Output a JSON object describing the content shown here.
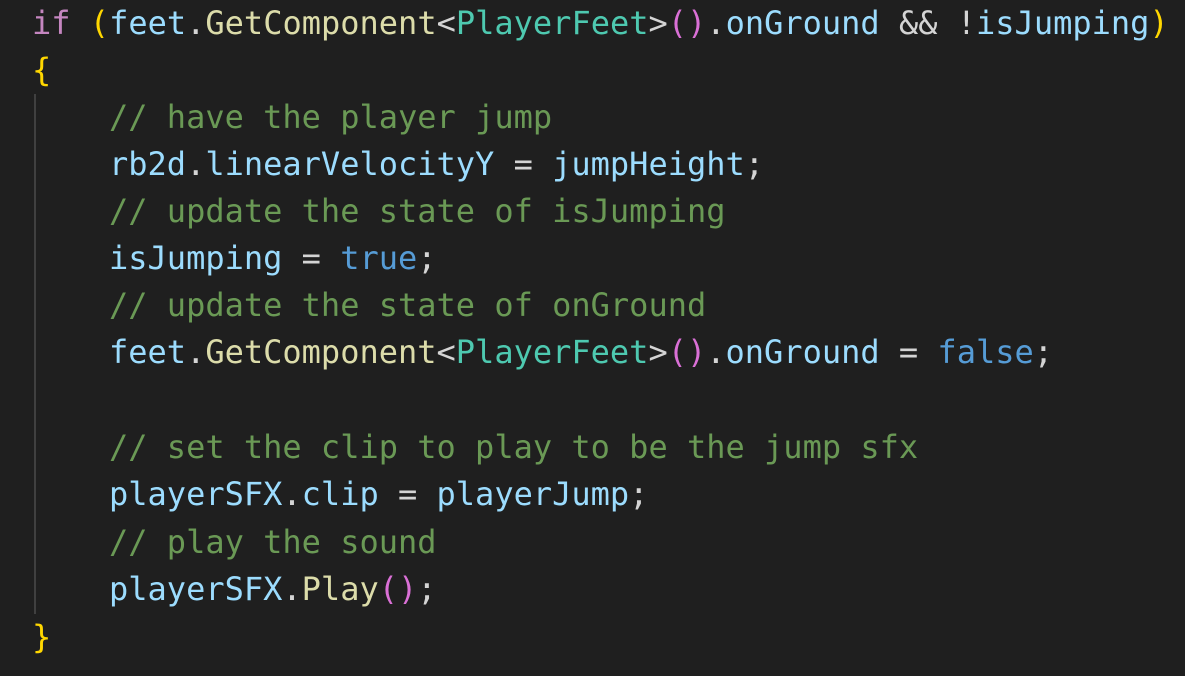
{
  "code": {
    "line1": {
      "kw_if": "if",
      "paren_open": "(",
      "feet": "feet",
      "dot1": ".",
      "get_component": "GetComponent",
      "lt": "<",
      "player_feet_type": "PlayerFeet",
      "gt": ">",
      "call_parens": "()",
      "dot2": ".",
      "on_ground": "onGround",
      "and_not": " && !",
      "is_jumping": "isJumping",
      "paren_close": ")"
    },
    "line2": {
      "brace_open": "{"
    },
    "line3": {
      "comment": "// have the player jump"
    },
    "line4": {
      "rb2d": "rb2d",
      "dot": ".",
      "linear_velocity_y": "linearVelocityY",
      "assign": " = ",
      "jump_height": "jumpHeight",
      "semi": ";"
    },
    "line5": {
      "comment": "// update the state of isJumping"
    },
    "line6": {
      "is_jumping": "isJumping",
      "assign": " = ",
      "true_value": "true",
      "semi": ";"
    },
    "line7": {
      "comment": "// update the state of onGround"
    },
    "line8": {
      "feet": "feet",
      "dot1": ".",
      "get_component": "GetComponent",
      "lt": "<",
      "player_feet_type": "PlayerFeet",
      "gt": ">",
      "call_parens": "()",
      "dot2": ".",
      "on_ground": "onGround",
      "assign": " = ",
      "false_value": "false",
      "semi": ";"
    },
    "line10": {
      "comment": "// set the clip to play to be the jump sfx"
    },
    "line11": {
      "player_sfx": "playerSFX",
      "dot": ".",
      "clip": "clip",
      "assign": " = ",
      "player_jump": "playerJump",
      "semi": ";"
    },
    "line12": {
      "comment": "// play the sound"
    },
    "line13": {
      "player_sfx": "playerSFX",
      "dot": ".",
      "play": "Play",
      "call_parens": "()",
      "semi": ";"
    },
    "line14": {
      "brace_close": "}"
    }
  },
  "theme": {
    "background": "#1f1f1f",
    "keyword": "#c586c0",
    "variable": "#9cdcfe",
    "function": "#dcdcaa",
    "type": "#4ec9b0",
    "comment": "#6a9955",
    "boolean": "#569cd6",
    "bracket_level1": "#ffd700",
    "bracket_level2": "#da70d6",
    "bracket_level3": "#179fff"
  }
}
